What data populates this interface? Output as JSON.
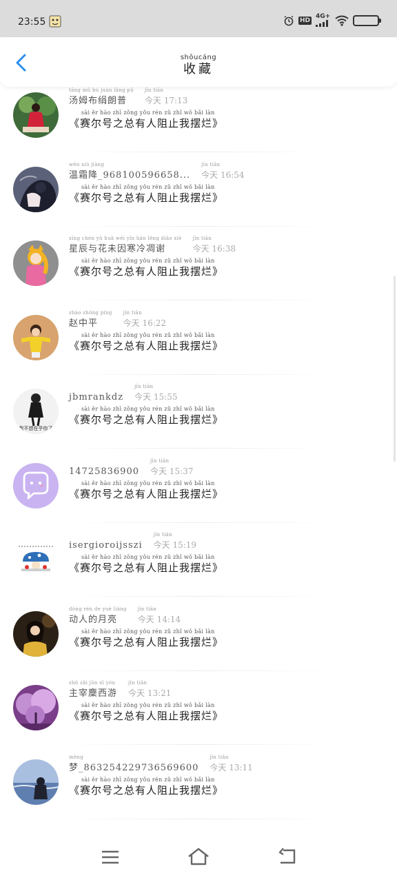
{
  "status_bar": {
    "time": "23:55",
    "network": "4G+",
    "hd": "HD"
  },
  "header": {
    "title_pinyin": "shōucáng",
    "title": "收藏"
  },
  "items": [
    {
      "name_pinyin": "tāng mǔ bù juàn lǎng pǔ",
      "name": "汤姆布绢朗普",
      "time_pinyin": "jīn tiān",
      "time": "今天 17:13",
      "content_pinyin": "sài ěr hào zhī zǒng yǒu rén zǔ zhǐ wǒ bǎi làn",
      "content": "《赛尔号之总有人阻止我摆烂》",
      "avatar": "red-dress-girl"
    },
    {
      "name_pinyin": "wēn xiù jiàng",
      "name": "温霜降_968100596658...",
      "time_pinyin": "jīn tiān",
      "time": "今天 16:54",
      "content_pinyin": "sài ěr hào zhī zǒng yǒu rén zǔ zhǐ wǒ bǎi làn",
      "content": "《赛尔号之总有人阻止我摆烂》",
      "avatar": "anime-couple"
    },
    {
      "name_pinyin": "xīng chén yǔ huā wèi yīn hán lěng diāo xiè",
      "name": "星辰与花未因寒冷凋谢",
      "time_pinyin": "jīn tiān",
      "time": "今天 16:38",
      "content_pinyin": "sài ěr hào zhī zǒng yǒu rén zǔ zhǐ wǒ bǎi làn",
      "content": "《赛尔号之总有人阻止我摆烂》",
      "avatar": "cartoon-fox-girl"
    },
    {
      "name_pinyin": "zhào zhōng píng",
      "name": "赵中平",
      "time_pinyin": "jīn tiān",
      "time": "今天 16:22",
      "content_pinyin": "sài ěr hào zhī zǒng yǒu rén zǔ zhǐ wǒ bǎi làn",
      "content": "《赛尔号之总有人阻止我摆烂》",
      "avatar": "child-yellow"
    },
    {
      "name_pinyin": "",
      "name": "jbmrankdz",
      "time_pinyin": "jīn tiān",
      "time": "今天 15:55",
      "content_pinyin": "sài ěr hào zhī zǒng yǒu rén zǔ zhǐ wǒ bǎi làn",
      "content": "《赛尔号之总有人阻止我摆烂》",
      "avatar": "bw-girl",
      "avatar_caption": "我不想在乎你了"
    },
    {
      "name_pinyin": "",
      "name": "14725836900",
      "time_pinyin": "jīn tiān",
      "time": "今天 15:37",
      "content_pinyin": "sài ěr hào zhī zǒng yǒu rén zǔ zhǐ wǒ bǎi làn",
      "content": "《赛尔号之总有人阻止我摆烂》",
      "avatar": "default-chat"
    },
    {
      "name_pinyin": "",
      "name": "isergioroijsszi",
      "time_pinyin": "jīn tiān",
      "time": "今天 15:19",
      "content_pinyin": "sài ěr hào zhī zǒng yǒu rén zǔ zhǐ wǒ bǎi làn",
      "content": "《赛尔号之总有人阻止我摆烂》",
      "avatar": "mushroom"
    },
    {
      "name_pinyin": "dòng rén de yuè liàng",
      "name": "动人的月亮",
      "time_pinyin": "jīn tiān",
      "time": "今天 14:14",
      "content_pinyin": "sài ěr hào zhī zǒng yǒu rén zǔ zhǐ wǒ bǎi làn",
      "content": "《赛尔号之总有人阻止我摆烂》",
      "avatar": "girl-yellow"
    },
    {
      "name_pinyin": "zhǔ zǎi jūn xī yóu",
      "name": "主宰麇西游",
      "time_pinyin": "jīn tiān",
      "time": "今天 13:21",
      "content_pinyin": "sài ěr hào zhī zǒng yǒu rén zǔ zhǐ wǒ bǎi làn",
      "content": "《赛尔号之总有人阻止我摆烂》",
      "avatar": "purple-tree"
    },
    {
      "name_pinyin": "mèng",
      "name": "梦_863254229736569600",
      "time_pinyin": "jīn tiān",
      "time": "今天 13:11",
      "content_pinyin": "sài ěr hào zhī zǒng yǒu rén zǔ zhǐ wǒ bǎi làn",
      "content": "《赛尔号之总有人阻止我摆烂》",
      "avatar": "sea-girl"
    }
  ],
  "colors": {
    "accent": "#2a8ff0",
    "statusbar": "#dcdcdc"
  }
}
